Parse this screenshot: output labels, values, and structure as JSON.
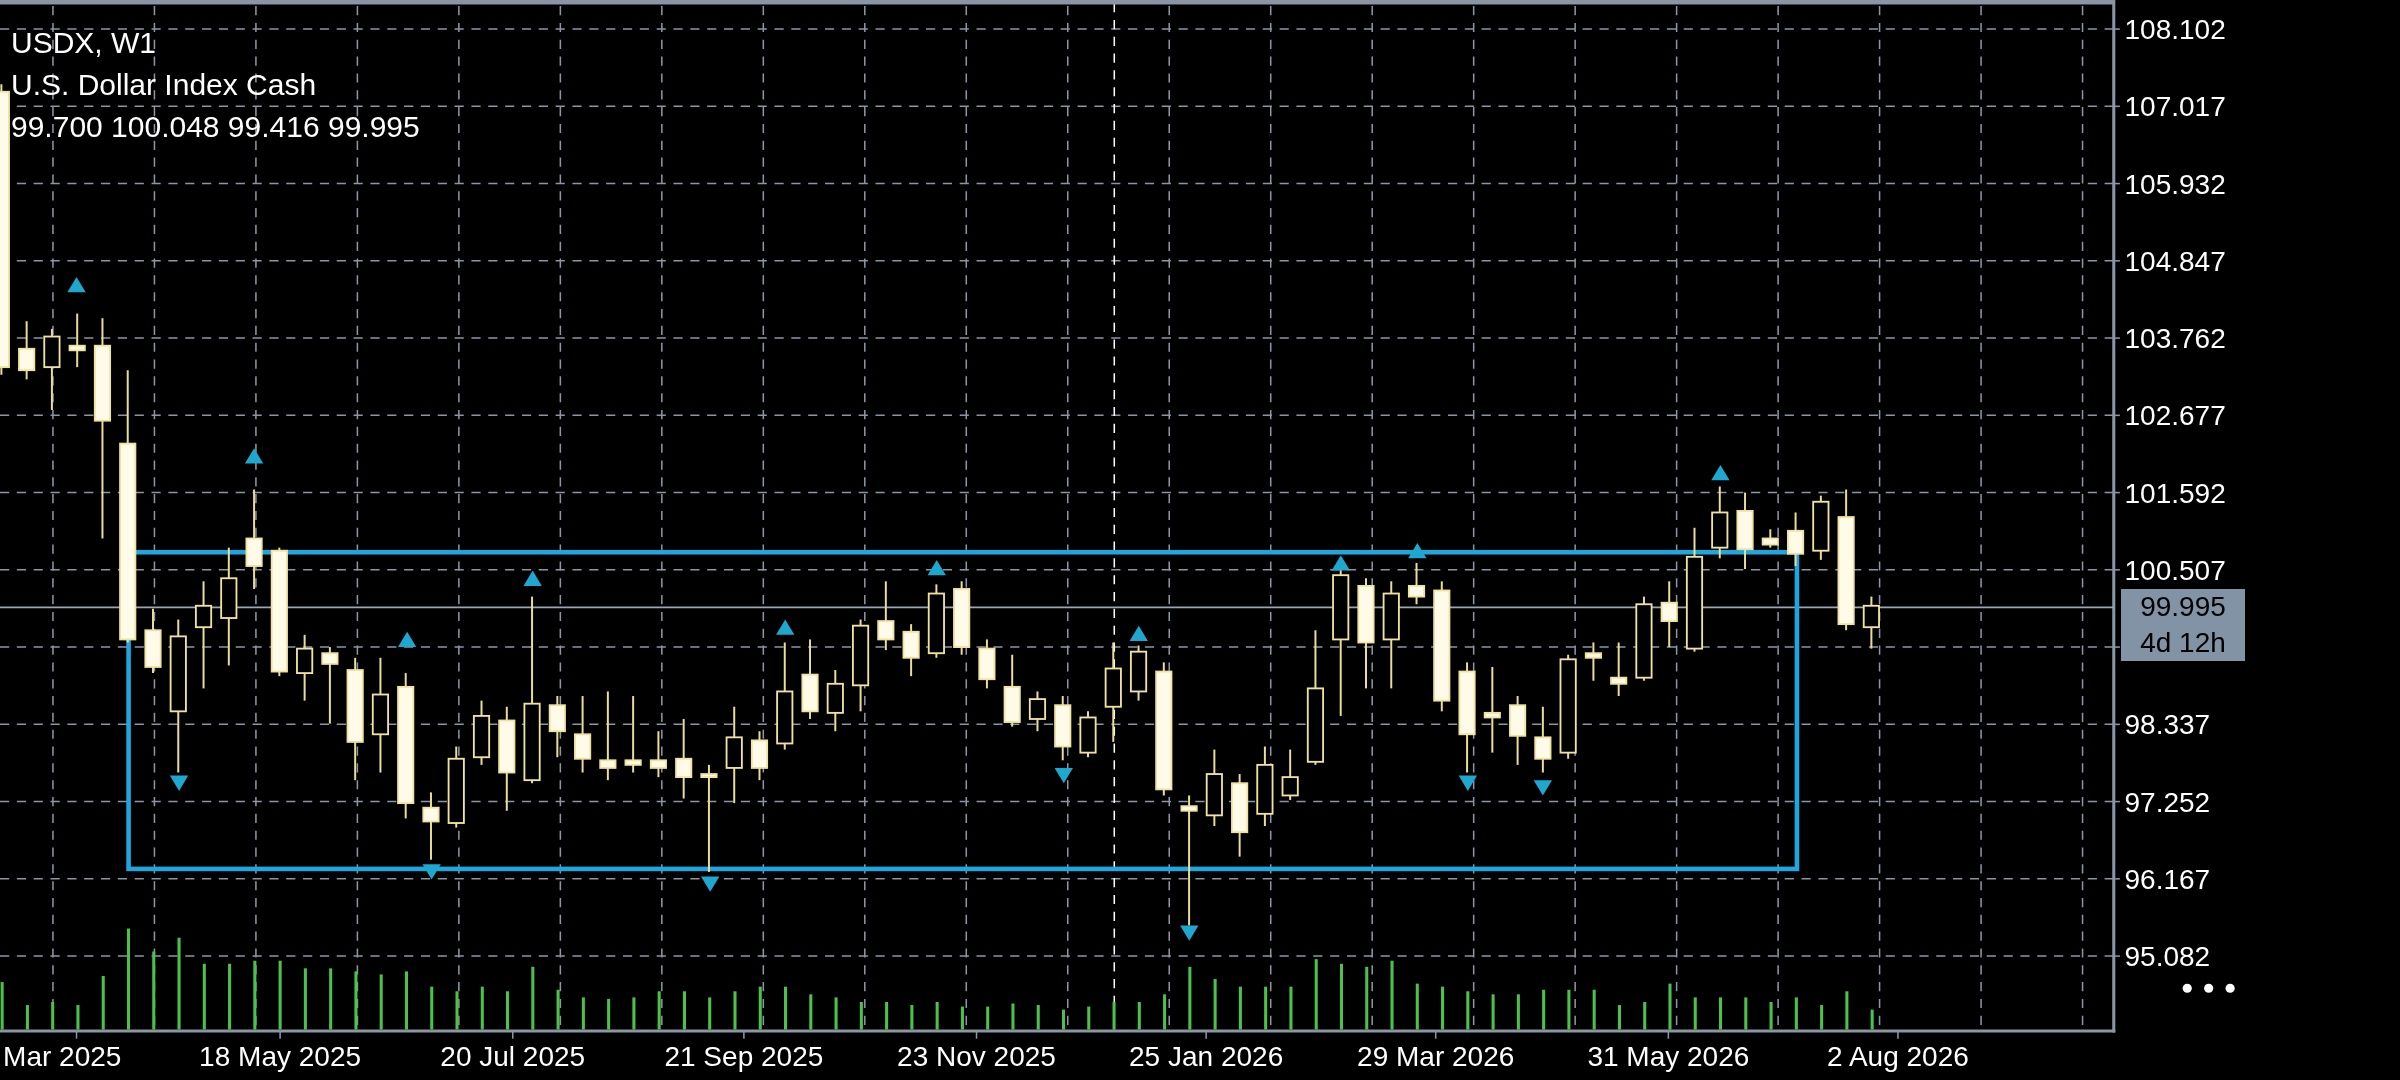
{
  "legend": {
    "symbol": "USDX, W1",
    "name": "U.S. Dollar Index Cash",
    "ohlc": "99.700 100.048 99.416 99.995"
  },
  "price_axis": {
    "ticks": [
      "108.102",
      "107.017",
      "105.932",
      "104.847",
      "103.762",
      "102.677",
      "101.592",
      "100.507",
      "98.337",
      "97.252",
      "96.167",
      "95.082"
    ]
  },
  "current_price": {
    "price": "99.995",
    "countdown": "4d 12h"
  },
  "time_axis": {
    "labels": [
      "Mar 2025",
      "18 May 2025",
      "20 Jul 2025",
      "21 Sep 2025",
      "23 Nov 2025",
      "25 Jan 2026",
      "29 Mar 2026",
      "31 May 2026",
      "2 Aug 2026"
    ]
  }
}
